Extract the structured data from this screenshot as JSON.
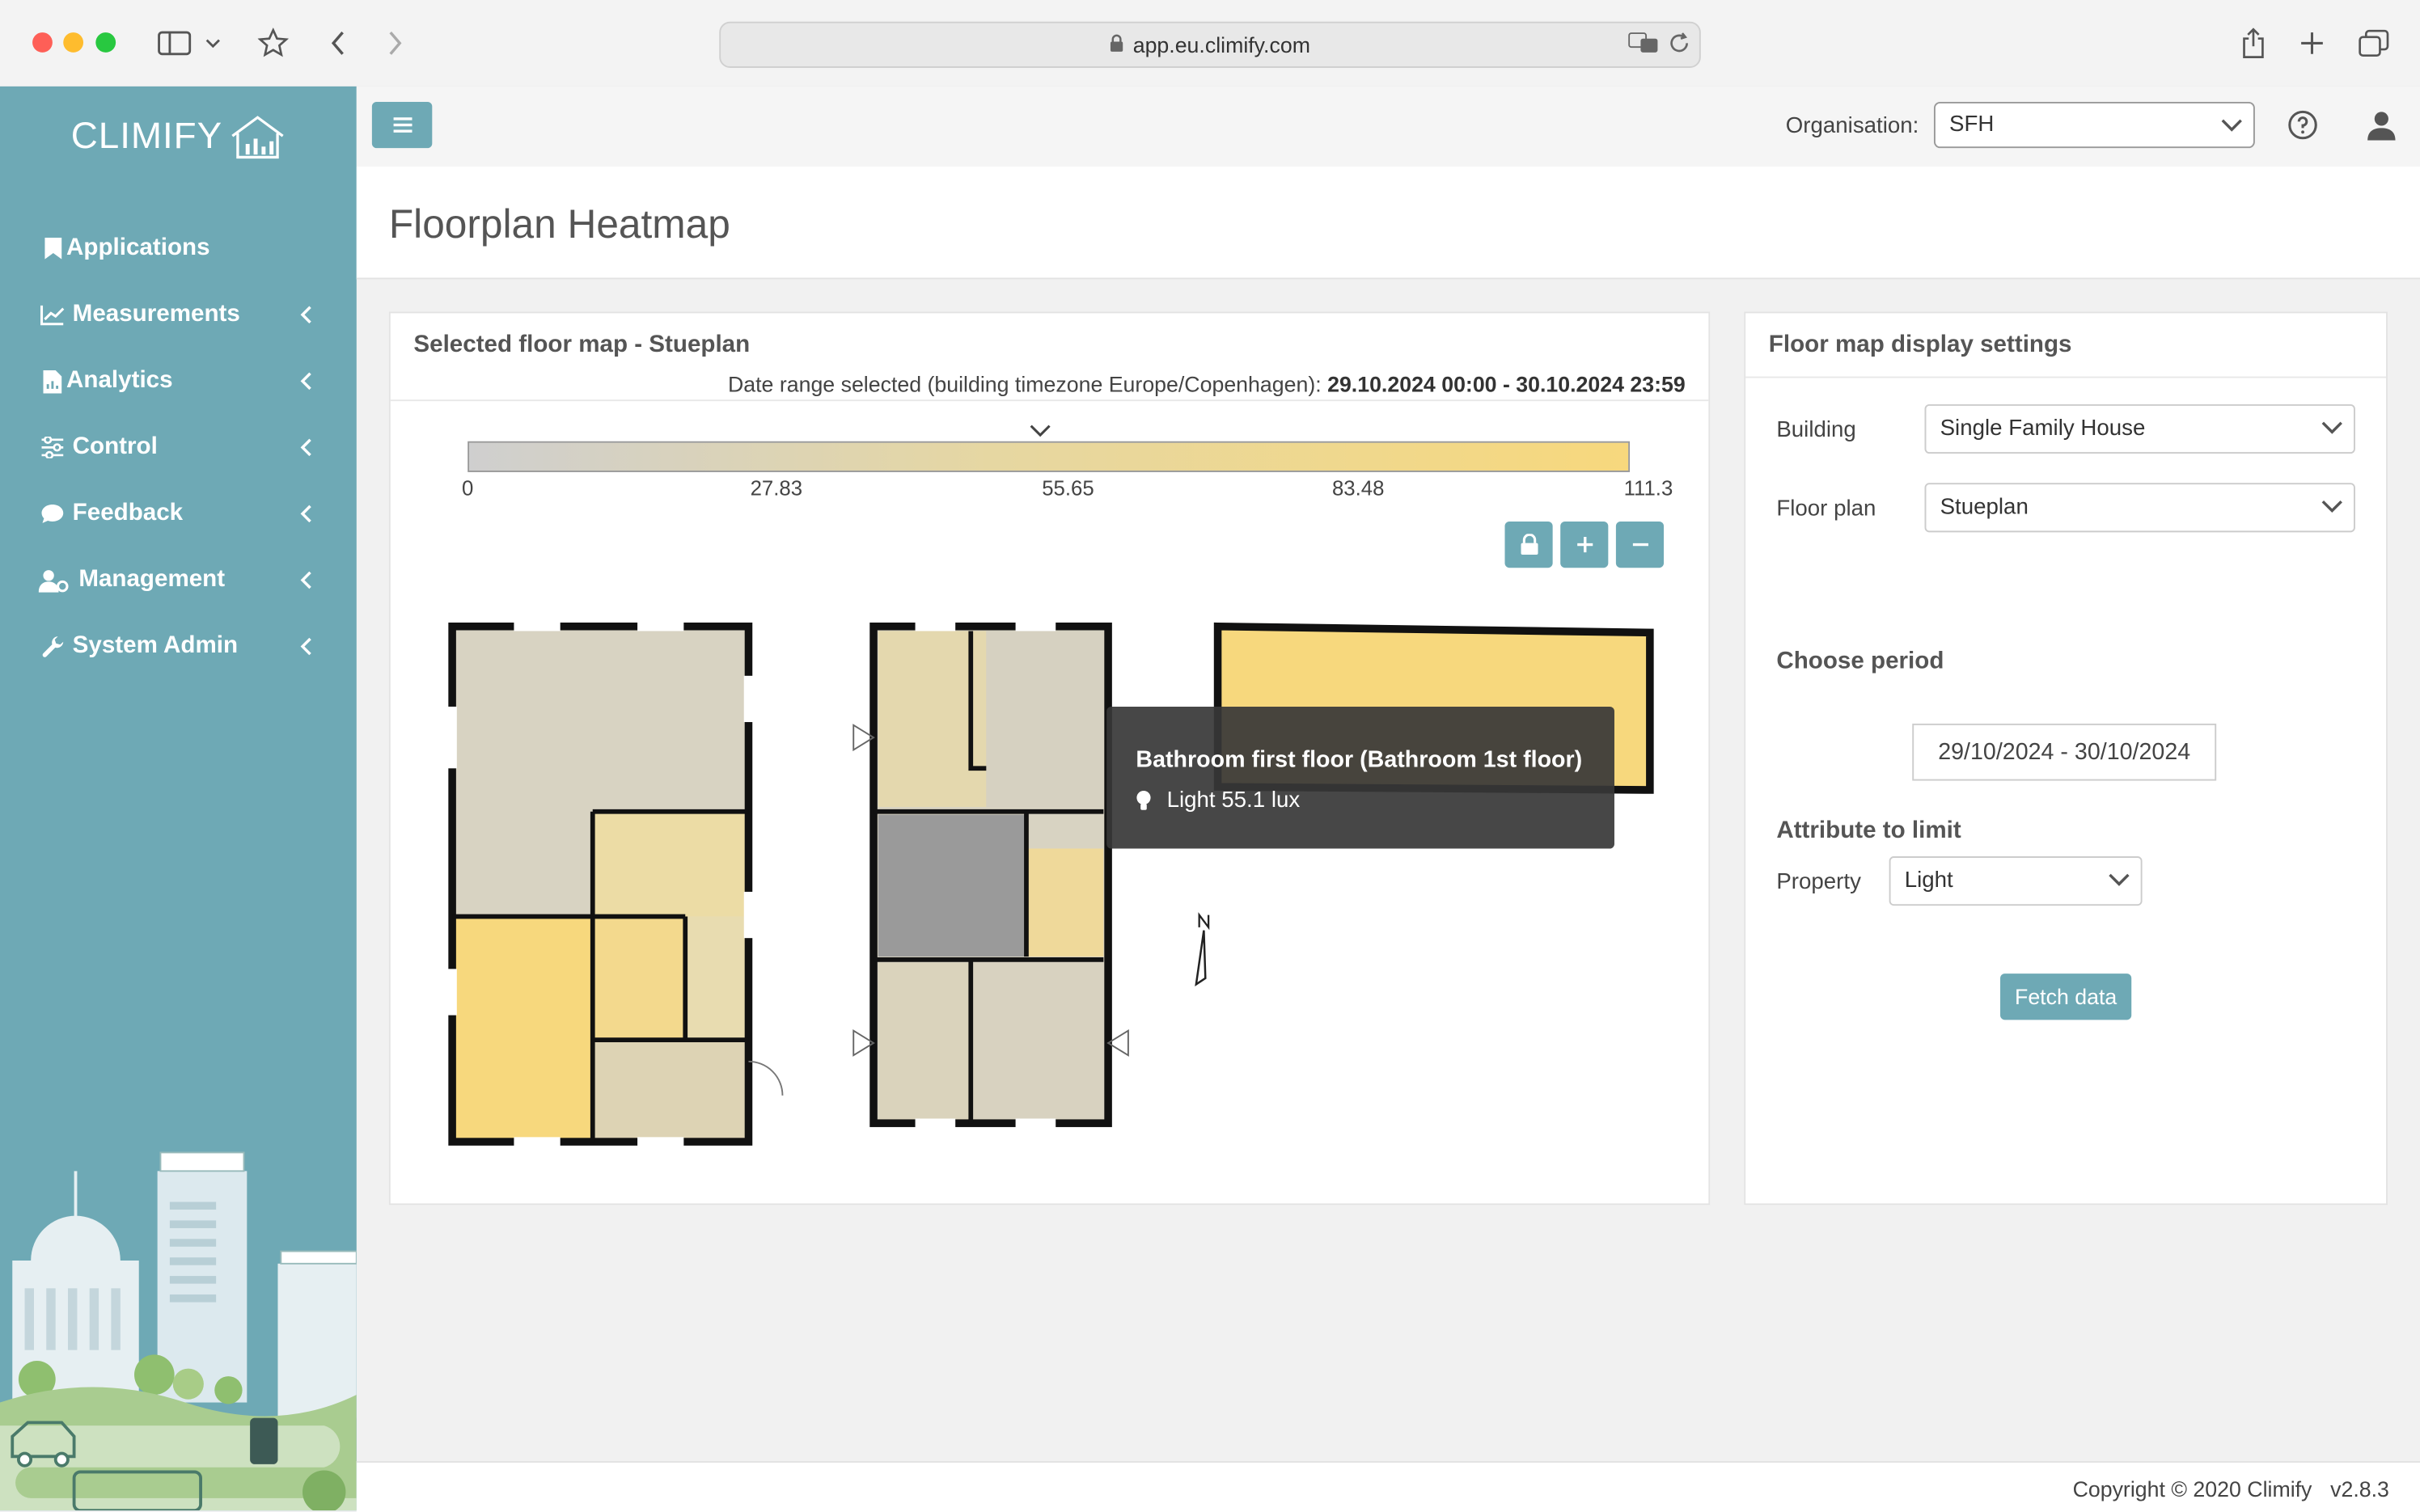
{
  "browser": {
    "url": "app.eu.climify.com"
  },
  "sidebar": {
    "logo_text": "CLIMIFY",
    "items": [
      {
        "label": "Applications",
        "icon": "bookmark-icon",
        "has_chevron": false
      },
      {
        "label": "Measurements",
        "icon": "line-chart-icon",
        "has_chevron": true
      },
      {
        "label": "Analytics",
        "icon": "file-chart-icon",
        "has_chevron": true
      },
      {
        "label": "Control",
        "icon": "sliders-icon",
        "has_chevron": true
      },
      {
        "label": "Feedback",
        "icon": "comment-icon",
        "has_chevron": true
      },
      {
        "label": "Management",
        "icon": "users-gear-icon",
        "has_chevron": true
      },
      {
        "label": "System Admin",
        "icon": "wrench-icon",
        "has_chevron": true
      }
    ]
  },
  "header": {
    "org_label": "Organisation:",
    "org_value": "SFH"
  },
  "page": {
    "title": "Floorplan Heatmap"
  },
  "floor_map": {
    "title": "Selected floor map - Stueplan",
    "date_range_label": "Date range selected (building timezone Europe/Copenhagen):",
    "date_range_value": "29.10.2024 00:00 - 30.10.2024 23:59",
    "scale_ticks": [
      "0",
      "27.83",
      "55.65",
      "83.48",
      "111.3"
    ],
    "scale_min_color": "#cfcfcf",
    "scale_max_color": "#f7d87d",
    "tooltip": {
      "title": "Bathroom first floor (Bathroom 1st floor)",
      "line": "Light 55.1 lux"
    }
  },
  "settings": {
    "title": "Floor map display settings",
    "building_label": "Building",
    "building_value": "Single Family House",
    "floorplan_label": "Floor plan",
    "floorplan_value": "Stueplan",
    "period_label": "Choose period",
    "period_value": "29/10/2024 - 30/10/2024",
    "attribute_label": "Attribute to limit",
    "property_label": "Property",
    "property_value": "Light",
    "fetch_label": "Fetch data"
  },
  "footer": {
    "copyright": "Copyright © 2020 Climify",
    "version": "v2.8.3"
  },
  "colors": {
    "accent": "#6ea9b5",
    "sidebar": "#6ea9b5",
    "tooltip_bg": "#373737"
  }
}
